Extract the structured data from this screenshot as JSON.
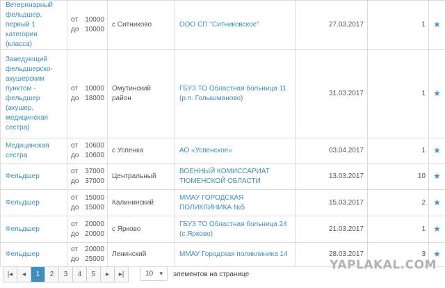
{
  "rows": [
    {
      "position": "Ветеринарный фельдшер, первый 1 категории (класса)",
      "pay_from_label": "от",
      "pay_from": "10000",
      "pay_to_label": "до",
      "pay_to": "10000",
      "location": "с Ситниково",
      "org": "ООО СП \"Ситниковское\"",
      "date": "27.03.2017",
      "count": "1"
    },
    {
      "position": "Заведующий фельдшерско-акушерским пунктом - фельдшер (акушер, медицинская сестра)",
      "pay_from_label": "от",
      "pay_from": "10000",
      "pay_to_label": "до",
      "pay_to": "18000",
      "location": "Омутинский район",
      "org": "ГБУЗ ТО Областная больница 11 (р.п. Голышманово)",
      "date": "31.03.2017",
      "count": "1"
    },
    {
      "position": "Медицинская сестра",
      "pay_from_label": "от",
      "pay_from": "10600",
      "pay_to_label": "до",
      "pay_to": "10600",
      "location": "с Успенка",
      "org": "АО «Успенское»",
      "date": "03.04.2017",
      "count": "1"
    },
    {
      "position": "Фельдшер",
      "pay_from_label": "от",
      "pay_from": "37000",
      "pay_to_label": "до",
      "pay_to": "37000",
      "location": "Центральный",
      "org": "ВОЕННЫЙ КОМИССАРИАТ ТЮМЕНСКОЙ ОБЛАСТИ",
      "date": "13.03.2017",
      "count": "10"
    },
    {
      "position": "Фельдшер",
      "pay_from_label": "от",
      "pay_from": "15000",
      "pay_to_label": "до",
      "pay_to": "15000",
      "location": "Калининский",
      "org": "ММАУ ГОРОДСКАЯ ПОЛИКЛИНИКА №5",
      "date": "15.03.2017",
      "count": "2"
    },
    {
      "position": "Фельдшер",
      "pay_from_label": "от",
      "pay_from": "20000",
      "pay_to_label": "до",
      "pay_to": "20000",
      "location": "с Ярково",
      "org": "ГБУЗ ТО Областная больница 24 (с.Ярково)",
      "date": "21.03.2017",
      "count": "1"
    },
    {
      "position": "Фельдшер",
      "pay_from_label": "от",
      "pay_from": "20000",
      "pay_to_label": "до",
      "pay_to": "25000",
      "location": "Ленинский",
      "org": "ММАУ Городская поликлиника 14",
      "date": "28.03.2017",
      "count": "3"
    }
  ],
  "star_glyph": "★",
  "pager": {
    "first": "|◂",
    "prev": "◂",
    "pages": [
      "1",
      "2",
      "3",
      "4",
      "5"
    ],
    "active_page": "1",
    "next": "▸",
    "last": "▸|"
  },
  "page_size": {
    "value": "10",
    "arrow": "▾",
    "label": "элементов на странице"
  },
  "watermark": "YAPLAKAL.COM",
  "colors": {
    "link": "#3a8fbf",
    "active_page": "#3a8fbf",
    "star": "#4a90c2"
  }
}
